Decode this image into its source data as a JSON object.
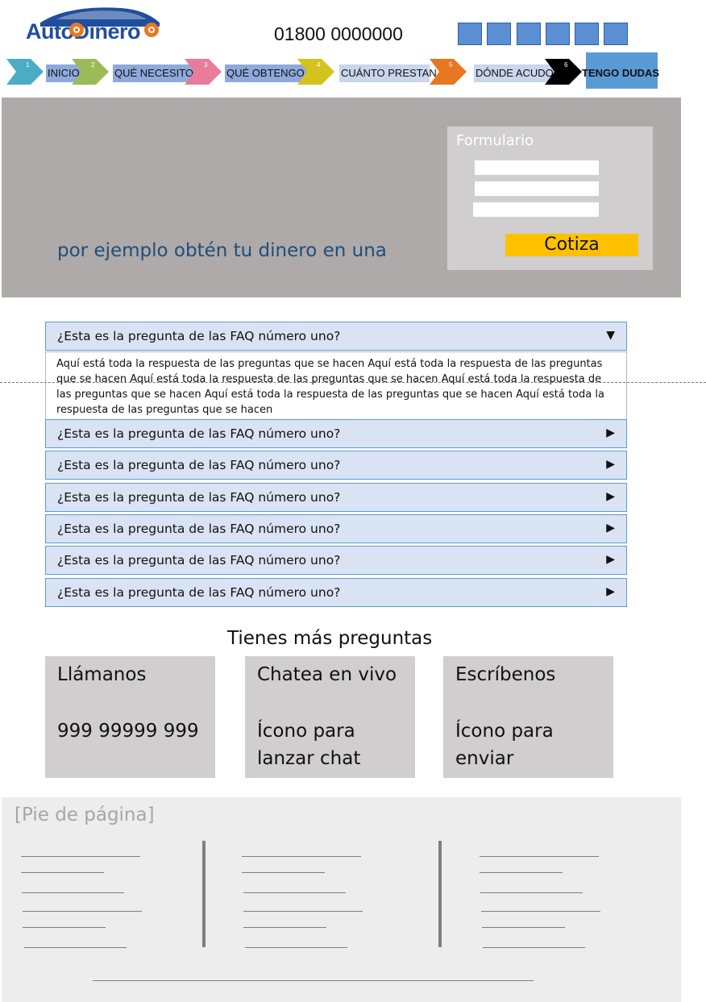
{
  "header": {
    "logo_text": "AutoDinero",
    "phone": "01800 0000000",
    "social_count": 6
  },
  "nav": [
    {
      "number": "1",
      "label": "INICIO",
      "color": "#4bacc6"
    },
    {
      "number": "2",
      "label": "QUÉ NECESITO",
      "color": "#9bbb59"
    },
    {
      "number": "3",
      "label": "QUÉ OBTENGO",
      "color": "#e97b9b"
    },
    {
      "number": "4",
      "label": "CUÁNTO PRESTAN",
      "color": "#d4c21d"
    },
    {
      "number": "5",
      "label": "DÓNDE ACUDO",
      "color": "#e87722"
    },
    {
      "number": "6",
      "label": "TENGO DUDAS",
      "color": "#000000"
    }
  ],
  "hero": {
    "text": "por ejemplo obtén tu dinero en una",
    "form": {
      "title": "Formulario",
      "submit_label": "Cotiza"
    }
  },
  "faq": {
    "expanded": {
      "question": "¿Esta es la pregunta de las FAQ número uno?",
      "answer": "Aquí está toda la respuesta de las preguntas que se hacen Aquí está toda la respuesta de las preguntas que se hacen Aquí está toda la respuesta de las preguntas que se hacen Aquí está toda la respuesta de las preguntas que se hacen Aquí está toda la respuesta de las preguntas que se hacen  Aquí está toda la respuesta de las preguntas que se hacen"
    },
    "items": [
      "¿Esta es la pregunta de las FAQ número uno?",
      "¿Esta es la pregunta de las FAQ número uno?",
      "¿Esta es la pregunta de las FAQ número uno?",
      "¿Esta es la pregunta de las FAQ número uno?",
      "¿Esta es la pregunta de las FAQ número uno?",
      "¿Esta es la pregunta de las FAQ número uno?"
    ]
  },
  "more": {
    "title": "Tienes más preguntas",
    "cards": [
      {
        "title": "Llámanos",
        "body": "999 99999 999"
      },
      {
        "title": "Chatea en vivo",
        "body": "Ícono para lanzar chat"
      },
      {
        "title": "Escríbenos",
        "body": "Ícono para enviar"
      }
    ]
  },
  "footer": {
    "title": "[Pie de página]"
  },
  "colors": {
    "accent": "#ffc000",
    "faq_bg": "#dae3f3",
    "faq_border": "#5b9bd5",
    "hero_bg": "#aeaaa9",
    "hero_text": "#1f4e79"
  }
}
